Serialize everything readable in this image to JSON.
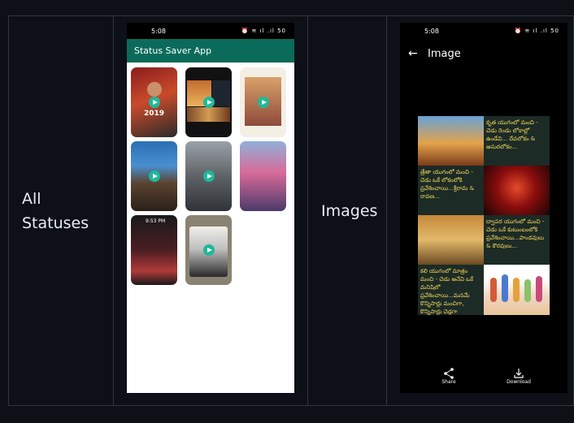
{
  "table": {
    "row_label_1_line1": "All",
    "row_label_1_line2": "Statuses",
    "row_label_2": "Images"
  },
  "phone1": {
    "status_time": "5:08",
    "status_icons": "⏰ ≋ ıl .ıl 50",
    "app_title": "Status Saver App",
    "thumb_year": "2019",
    "thumb_time": "9:53 PM"
  },
  "phone2": {
    "status_time": "5:08",
    "status_icons": "⏰ ≋ ıl .ıl 50",
    "back_glyph": "←",
    "title": "Image",
    "tiles": [
      "కృత యుగంలో మంచి - చెడు రెండు లోకాల్లో ఉండేవి... దేవలోకం & అసురలోకం...",
      "త్రేతా యుగంలో మంచి - చెడు ఒకే లోకంలోకి ప్రవేశించాయి...శ్రీరామ & రావణ...",
      "ద్వాపర యుగంలో మంచి - చెడు ఒకే కుటుంబంలోకి ప్రవేశించాయి...పాండవులు & కౌరవులు...",
      "కలి యుగంలో మాత్రం మంచి - చెడు అనేవి ఒకే మనిషిలో ప్రవేశించాయి...మనమే కొన్నిసార్లు మంచిగా, కొన్నిసార్లు చెడ్డగా ప్రవర్తిస్తుంటాం..."
    ],
    "share_label": "Share",
    "download_label": "Download"
  }
}
